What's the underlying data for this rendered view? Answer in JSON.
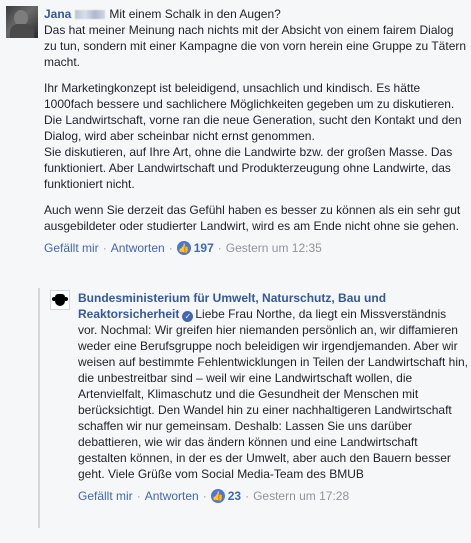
{
  "comment1": {
    "author": "Jana",
    "headline": "Mit einem Schalk in den Augen?",
    "intro": "Das hat meiner Meinung nach nichts mit der Absicht von einem fairem Dialog zu tun, sondern mit einer Kampagne die von vorn herein eine Gruppe zu Tätern macht.",
    "paragraph2": "Ihr Marketingkonzept ist beleidigend, unsachlich und kindisch. Es hätte 1000fach bessere und sachlichere Möglichkeiten gegeben um zu diskutieren.\nDie Landwirtschaft, vorne ran die neue Generation, sucht den Kontakt und den Dialog, wird aber scheinbar nicht ernst genommen.\nSie diskutieren, auf Ihre Art, ohne die Landwirte bzw. der großen Masse. Das funktioniert. Aber Landwirtschaft und Produkterzeugung ohne Landwirte, das funktioniert nicht.",
    "paragraph3": "Auch wenn Sie derzeit das Gefühl haben es besser zu können als ein sehr gut ausgebildeter oder studierter Landwirt, wird es am Ende nicht ohne sie gehen.",
    "like_label": "Gefällt mir",
    "reply_label": "Antworten",
    "like_count": "197",
    "timestamp": "Gestern um 12:35"
  },
  "comment2": {
    "author": "Bundesministerium für Umwelt, Naturschutz, Bau und Reaktorsicherheit",
    "verified_icon": "verified-checkmark",
    "text": "Liebe Frau Northe, da liegt ein Missverständnis vor. Nochmal: Wir greifen hier niemanden persönlich an, wir diffamieren weder eine Berufsgruppe noch beleidigen wir irgendjemanden. Aber wir weisen auf bestimmte Fehlentwicklungen in Teilen der Landwirtschaft hin, die unbestreitbar sind – weil wir eine Landwirtschaft wollen, die Artenvielfalt, Klimaschutz und die Gesundheit der Menschen mit berücksichtigt. Den Wandel hin zu einer nachhaltigeren Landwirtschaft schaffen wir nur gemeinsam. Deshalb: Lassen Sie uns darüber debattieren, wie wir das ändern können und eine Landwirtschaft gestalten können, in der es der Umwelt, aber auch den Bauern besser geht. Viele Grüße vom Social Media-Team des BMUB",
    "like_label": "Gefällt mir",
    "reply_label": "Antworten",
    "like_count": "23",
    "timestamp": "Gestern um 17:28"
  },
  "colors": {
    "link": "#4267b2",
    "author": "#365899",
    "meta": "#90949c"
  }
}
